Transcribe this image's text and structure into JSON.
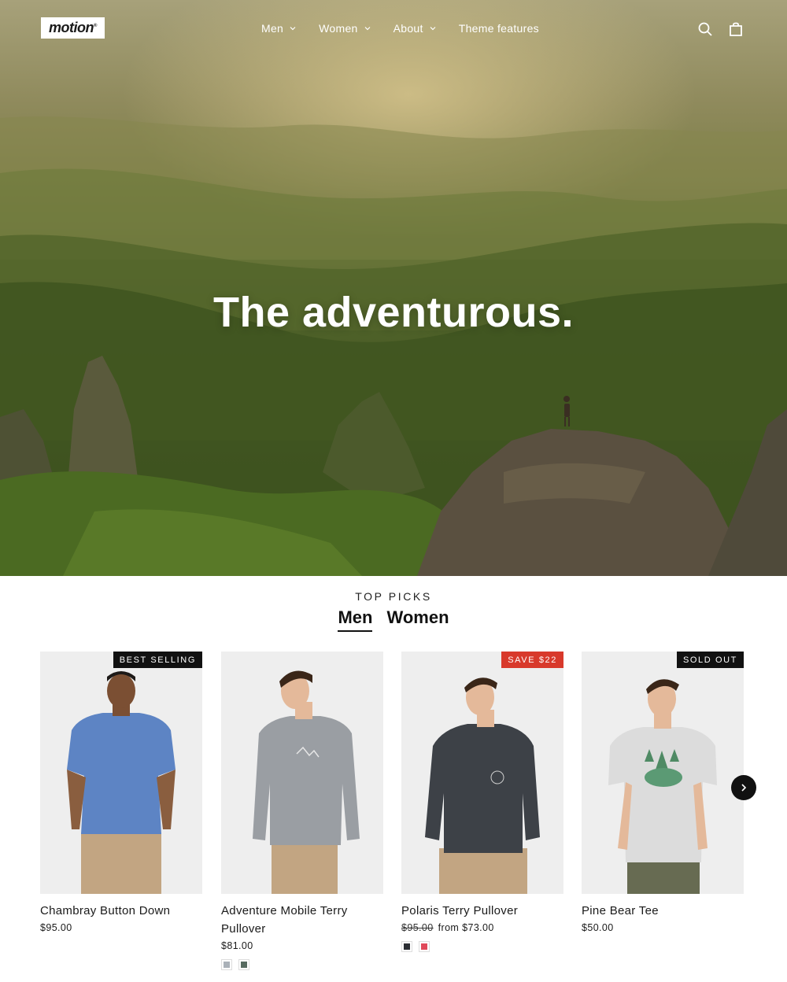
{
  "header": {
    "logo_text": "motion",
    "logo_mark": "®",
    "nav": [
      {
        "label": "Men",
        "has_dropdown": true
      },
      {
        "label": "Women",
        "has_dropdown": true
      },
      {
        "label": "About",
        "has_dropdown": true
      },
      {
        "label": "Theme features",
        "has_dropdown": false
      }
    ],
    "icons": [
      "search-icon",
      "cart-icon"
    ]
  },
  "hero": {
    "title": "The adventurous."
  },
  "top_picks": {
    "label": "TOP PICKS",
    "tabs": [
      {
        "label": "Men",
        "active": true
      },
      {
        "label": "Women",
        "active": false
      }
    ]
  },
  "products": [
    {
      "title": "Chambray Button Down",
      "badge": "BEST SELLING",
      "badge_color": "#111111",
      "price": "$95.00",
      "shirt_color": "#5d84c4",
      "pants_color": "#c2a582",
      "swatches": []
    },
    {
      "title": "Adventure Mobile Terry Pullover",
      "badge": "",
      "badge_color": "",
      "price": "$81.00",
      "shirt_color": "#9a9ea3",
      "pants_color": "#c2a582",
      "swatches": [
        "#aab1b8",
        "#566a5f"
      ]
    },
    {
      "title": "Polaris Terry Pullover",
      "badge": "SAVE $22",
      "badge_color": "#d8392b",
      "price_original": "$95.00",
      "price_from": "from $73.00",
      "shirt_color": "#3d4147",
      "pants_color": "#c2a582",
      "swatches": [
        "#2b2e33",
        "#e0495a"
      ]
    },
    {
      "title": "Pine Bear Tee",
      "badge": "SOLD OUT",
      "badge_color": "#111111",
      "price": "$50.00",
      "shirt_color": "#dcdcdc",
      "pants_color": "#676b52",
      "swatches": []
    }
  ],
  "carousel": {
    "next_icon": "chevron-right-icon"
  }
}
